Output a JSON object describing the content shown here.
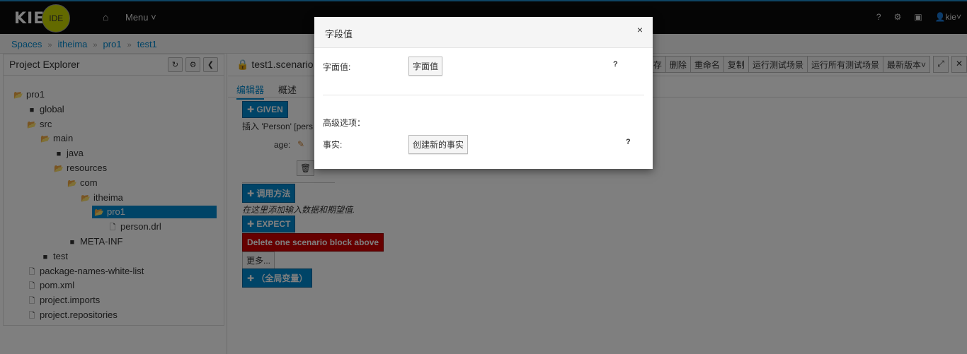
{
  "navbar": {
    "logo_text": "KIE",
    "logo_badge": "IDE",
    "home_icon": "home-icon",
    "menu_label": "Menu",
    "help_icon_glyph": "?",
    "settings_icon_glyph": "⚙",
    "camera_icon_glyph": "▣",
    "user_label": "kie"
  },
  "breadcrumb": [
    "Spaces",
    "itheima",
    "pro1",
    "test1"
  ],
  "project_explorer": {
    "title": "Project Explorer",
    "tree": [
      {
        "label": "pro1",
        "icon": "folder-open-icon",
        "depth": 0
      },
      {
        "label": "global",
        "icon": "folder-icon",
        "depth": 1
      },
      {
        "label": "src",
        "icon": "folder-open-icon",
        "depth": 1
      },
      {
        "label": "main",
        "icon": "folder-open-icon",
        "depth": 2
      },
      {
        "label": "java",
        "icon": "folder-icon",
        "depth": 3
      },
      {
        "label": "resources",
        "icon": "folder-open-icon",
        "depth": 3
      },
      {
        "label": "com",
        "icon": "folder-open-icon",
        "depth": 4
      },
      {
        "label": "itheima",
        "icon": "folder-open-icon",
        "depth": 5
      },
      {
        "label": "pro1",
        "icon": "folder-open-icon",
        "depth": 6,
        "selected": true
      },
      {
        "label": "person.drl",
        "icon": "file-icon",
        "depth": 7
      },
      {
        "label": "META-INF",
        "icon": "folder-icon",
        "depth": 4
      },
      {
        "label": "test",
        "icon": "folder-icon",
        "depth": 2
      },
      {
        "label": "package-names-white-list",
        "icon": "file-icon",
        "depth": 1
      },
      {
        "label": "pom.xml",
        "icon": "file-icon",
        "depth": 1
      },
      {
        "label": "project.imports",
        "icon": "file-icon",
        "depth": 1
      },
      {
        "label": "project.repositories",
        "icon": "file-icon",
        "depth": 1
      }
    ]
  },
  "editor": {
    "title": "test1.scenario -",
    "toolbar": [
      "存",
      "删除",
      "重命名",
      "复制",
      "运行测试场景",
      "运行所有测试场景",
      "最新版本"
    ],
    "tabs": [
      "编辑器",
      "概述"
    ],
    "given_label": "GIVEN",
    "insert_text": "插入 'Person'  [pers",
    "age_label": "age:",
    "call_method_label": "调用方法",
    "hint_text": "在这里添加输入数据和期望值.",
    "expect_label": "EXPECT",
    "delete_block_label": "Delete one scenario block above",
    "more_label": "更多...",
    "globals_label": "（全局变量）"
  },
  "modal": {
    "title": "字段值",
    "close_glyph": "×",
    "literal_label": "字面值:",
    "literal_button": "字面值",
    "advanced_label": "高级选项：",
    "fact_label": "事实:",
    "fact_button": "创建新的事实",
    "help_glyph": "?"
  }
}
